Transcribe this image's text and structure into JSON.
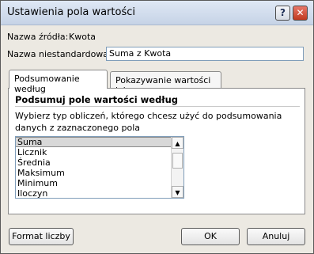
{
  "title": "Ustawienia pola wartości",
  "titlebar": {
    "help": "?",
    "close": "✕"
  },
  "source": {
    "label": "Nazwa źródła:",
    "value": "Kwota"
  },
  "custom": {
    "label": "Nazwa niestandardowa:",
    "value": "Suma z Kwota"
  },
  "tabs": [
    {
      "label": "Podsumowanie według"
    },
    {
      "label": "Pokazywanie wartości jako"
    }
  ],
  "panel": {
    "heading": "Podsumuj pole wartości według",
    "description_line1": "Wybierz typ obliczeń, którego chcesz użyć do podsumowania",
    "description_line2": "danych z zaznaczonego pola"
  },
  "list": {
    "items": [
      "Suma",
      "Licznik",
      "Średnia",
      "Maksimum",
      "Minimum",
      "Iloczyn"
    ],
    "selected": "Suma"
  },
  "scroll": {
    "up": "▲",
    "down": "▼"
  },
  "buttons": {
    "format": "Format liczby",
    "ok": "OK",
    "cancel": "Anuluj"
  }
}
